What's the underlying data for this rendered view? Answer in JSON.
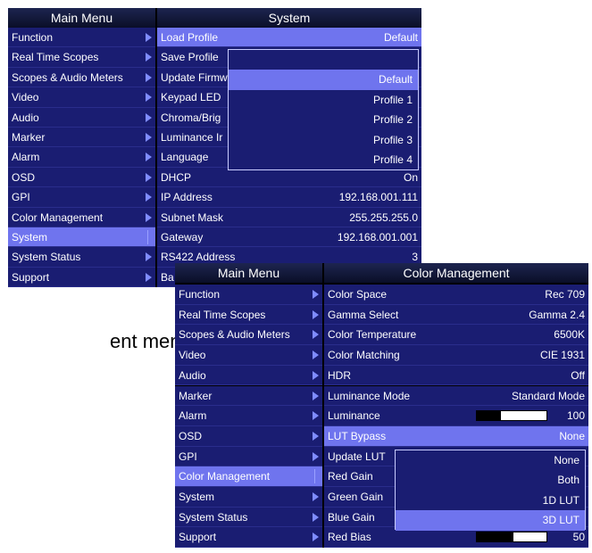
{
  "caption": "ent menu.",
  "top": {
    "main_menu_title": "Main Menu",
    "main_items": [
      {
        "label": "Function"
      },
      {
        "label": "Real Time Scopes"
      },
      {
        "label": "Scopes & Audio Meters"
      },
      {
        "label": "Video"
      },
      {
        "label": "Audio"
      },
      {
        "label": "Marker"
      },
      {
        "label": "Alarm"
      },
      {
        "label": "OSD"
      },
      {
        "label": "GPI"
      },
      {
        "label": "Color Management"
      },
      {
        "label": "System",
        "selected": true
      },
      {
        "label": "System Status"
      },
      {
        "label": "Support"
      }
    ],
    "sub_title": "System",
    "sub_items": [
      {
        "label": "Load Profile",
        "value": "Default",
        "selected": true
      },
      {
        "label": "Save Profile",
        "value": ""
      },
      {
        "label": "Update Firmw",
        "value": ""
      },
      {
        "label": "Keypad LED",
        "value": ""
      },
      {
        "label": "Chroma/Brig",
        "value": ""
      },
      {
        "label": "Luminance Ir",
        "value": ""
      },
      {
        "label": "Language",
        "value": ""
      },
      {
        "label": "DHCP",
        "value": "On"
      },
      {
        "label": "IP Address",
        "value": "192.168.001.111"
      },
      {
        "label": "Subnet Mask",
        "value": "255.255.255.0"
      },
      {
        "label": "Gateway",
        "value": "192.168.001.001"
      },
      {
        "label": "RS422 Address",
        "value": "3"
      },
      {
        "label": "Ba",
        "value": ""
      }
    ],
    "dropdown": [
      "",
      "Default",
      "Profile 1",
      "Profile 2",
      "Profile 3",
      "Profile 4"
    ],
    "dropdown_selected_index": 1
  },
  "bottom": {
    "main_menu_title": "Main Menu",
    "main_items": [
      {
        "label": "Function"
      },
      {
        "label": "Real Time Scopes"
      },
      {
        "label": "Scopes & Audio Meters"
      },
      {
        "label": "Video"
      },
      {
        "label": "Audio"
      },
      {
        "label": "Marker"
      },
      {
        "label": "Alarm"
      },
      {
        "label": "OSD"
      },
      {
        "label": "GPI"
      },
      {
        "label": "Color Management",
        "selected": true
      },
      {
        "label": "System"
      },
      {
        "label": "System Status"
      },
      {
        "label": "Support"
      }
    ],
    "sub_title": "Color Management",
    "sub_items": [
      {
        "label": "Color Space",
        "value": "Rec 709"
      },
      {
        "label": "Gamma Select",
        "value": "Gamma 2.4"
      },
      {
        "label": "Color Temperature",
        "value": "6500K"
      },
      {
        "label": "Color Matching",
        "value": "CIE 1931"
      },
      {
        "label": "HDR",
        "value": "Off"
      },
      {
        "label": "Luminance Mode",
        "value": "Standard Mode"
      },
      {
        "label": "Luminance",
        "value": "100",
        "level": 0.35
      },
      {
        "label": "LUT Bypass",
        "value": "None",
        "selected": true
      },
      {
        "label": "Update LUT",
        "value": ""
      },
      {
        "label": "Red Gain",
        "value": ""
      },
      {
        "label": "Green Gain",
        "value": ""
      },
      {
        "label": "Blue Gain",
        "value": ""
      },
      {
        "label": "Red Bias",
        "value": "50",
        "level": 0.53
      }
    ],
    "dropdown": [
      "None",
      "Both",
      "1D LUT",
      "3D LUT"
    ],
    "dropdown_selected_index": 3
  }
}
